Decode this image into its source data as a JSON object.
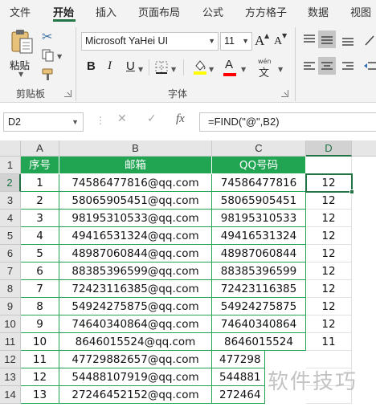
{
  "ribbon_tabs": [
    "文件",
    "开始",
    "插入",
    "页面布局",
    "公式",
    "方方格子",
    "数据",
    "视图"
  ],
  "active_tab": "开始",
  "clipboard": {
    "paste_label": "粘贴",
    "group_label": "剪贴板"
  },
  "font": {
    "name": "Microsoft YaHei UI",
    "size": "11",
    "group_label": "字体",
    "grow_label": "A",
    "shrink_label": "A",
    "bold_label": "B",
    "italic_label": "I",
    "underline_label": "U",
    "color_label": "A",
    "phonetic_label": "wén",
    "highlight_color": "#ffff00",
    "font_color": "#ff0000"
  },
  "formula_bar": {
    "name_box": "D2",
    "cancel_symbol": "✕",
    "enter_symbol": "✓",
    "fx_label": "fx",
    "formula": "=FIND(\"@\",B2)"
  },
  "columns": [
    "A",
    "B",
    "C",
    "D"
  ],
  "selected_column": "D",
  "rows": [
    "1",
    "2",
    "3",
    "4",
    "5",
    "6",
    "7",
    "8",
    "9",
    "10",
    "11",
    "12",
    "13",
    "14"
  ],
  "selected_row": "2",
  "table": {
    "headers": [
      "序号",
      "邮箱",
      "QQ号码"
    ],
    "records": [
      {
        "no": "1",
        "email": "74586477816@qq.com",
        "qq": "74586477816",
        "d": "12"
      },
      {
        "no": "2",
        "email": "58065905451@qq.com",
        "qq": "58065905451",
        "d": "12"
      },
      {
        "no": "3",
        "email": "98195310533@qq.com",
        "qq": "98195310533",
        "d": "12"
      },
      {
        "no": "4",
        "email": "49416531324@qq.com",
        "qq": "49416531324",
        "d": "12"
      },
      {
        "no": "5",
        "email": "48987060844@qq.com",
        "qq": "48987060844",
        "d": "12"
      },
      {
        "no": "6",
        "email": "88385396599@qq.com",
        "qq": "88385396599",
        "d": "12"
      },
      {
        "no": "7",
        "email": "72423116385@qq.com",
        "qq": "72423116385",
        "d": "12"
      },
      {
        "no": "8",
        "email": "54924275875@qq.com",
        "qq": "54924275875",
        "d": "12"
      },
      {
        "no": "9",
        "email": "74640340864@qq.com",
        "qq": "74640340864",
        "d": "12"
      },
      {
        "no": "10",
        "email": "8646015524@qq.com",
        "qq": "8646015524",
        "d": "11"
      },
      {
        "no": "11",
        "email": "47729882657@qq.com",
        "qq": "477298",
        "d": ""
      },
      {
        "no": "12",
        "email": "54488107919@qq.com",
        "qq": "544881",
        "d": ""
      },
      {
        "no": "13",
        "email": "27246452152@qq.com",
        "qq": "272464",
        "d": ""
      }
    ]
  },
  "watermark": "软件技巧",
  "colors": {
    "accent": "#217346",
    "header_fill": "#21a553"
  }
}
